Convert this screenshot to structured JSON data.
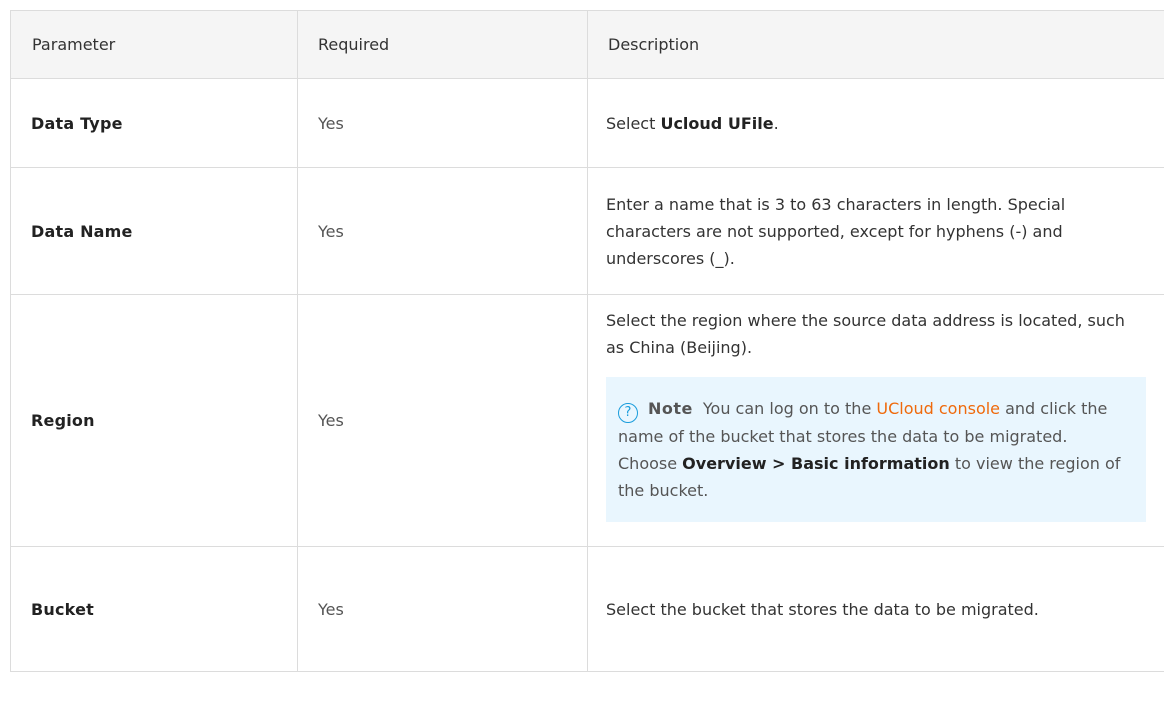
{
  "table": {
    "headers": [
      "Parameter",
      "Required",
      "Description"
    ],
    "rows": [
      {
        "parameter": "Data Type",
        "required": "Yes",
        "desc_prefix": "Select ",
        "desc_bold": "Ucloud UFile",
        "desc_suffix": "."
      },
      {
        "parameter": "Data Name",
        "required": "Yes",
        "description": "Enter a name that is 3 to 63 characters in length. Special characters are not supported, except for hyphens (-) and underscores (_)."
      },
      {
        "parameter": "Region",
        "required": "Yes",
        "description": "Select the region where the source data address is located, such as China (Beijing).",
        "note": {
          "icon": "question-circle-icon",
          "label": "Note",
          "text_before_link": "You can log on to the ",
          "link_text": "UCloud console",
          "text_after_link": " and click the name of the bucket that stores the data to be migrated. Choose ",
          "path_bold": "Overview > Basic information",
          "text_end": " to view the region of the bucket."
        }
      },
      {
        "parameter": "Bucket",
        "required": "Yes",
        "description": "Select the bucket that stores the data to be migrated."
      }
    ]
  },
  "colors": {
    "header_bg": "#f5f5f5",
    "note_bg": "#e9f6fe",
    "link": "#ef6a0c",
    "icon": "#1a9ddc",
    "border": "#dcdcdc"
  }
}
